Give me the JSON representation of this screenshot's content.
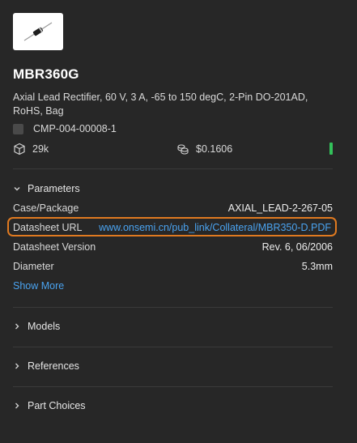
{
  "part": {
    "number": "MBR360G",
    "description": "Axial Lead Rectifier, 60 V, 3 A, -65 to 150 degC, 2-Pin DO-201AD, RoHS, Bag",
    "cmp_id": "CMP-004-00008-1",
    "stock": "29k",
    "price": "$0.1606",
    "status_color": "#33c15a"
  },
  "parameters": {
    "title": "Parameters",
    "rows": [
      {
        "label": "Case/Package",
        "value": "AXIAL_LEAD-2-267-05"
      },
      {
        "label": "Datasheet URL",
        "value": "www.onsemi.cn/pub_link/Collateral/MBR350-D.PDF"
      },
      {
        "label": "Datasheet Version",
        "value": "Rev. 6, 06/2006"
      },
      {
        "label": "Diameter",
        "value": "5.3mm"
      }
    ],
    "show_more": "Show More"
  },
  "sections": {
    "models": "Models",
    "references": "References",
    "part_choices": "Part Choices"
  },
  "colors": {
    "background": "#272727",
    "link": "#4aa3f0",
    "highlight": "#e07a20"
  }
}
